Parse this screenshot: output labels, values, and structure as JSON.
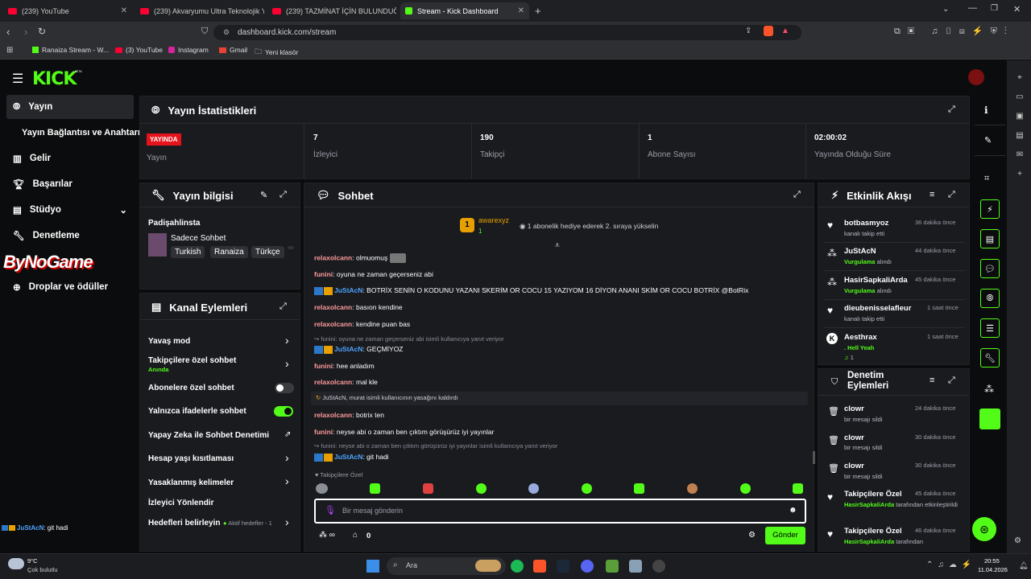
{
  "browser": {
    "tabs": [
      {
        "label": "(239) YouTube"
      },
      {
        "label": "(239) Akvaryumu Ultra Teknolojik Yap"
      },
      {
        "label": "(239) TAZMİNAT İÇİN BULUNDUĞU Ü"
      },
      {
        "label": "Stream - Kick Dashboard"
      }
    ],
    "url": "dashboard.kick.com/stream",
    "bookmarks": [
      "Ranaiza Stream - W...",
      "(3) YouTube",
      "Instagram",
      "Gmail",
      "Yeni klasör"
    ]
  },
  "sidebar": {
    "items": [
      {
        "label": "Yayın"
      },
      {
        "label": "Yayın Bağlantısı ve Anahtarı"
      },
      {
        "label": "Gelir"
      },
      {
        "label": "Başarılar"
      },
      {
        "label": "Stüdyo"
      },
      {
        "label": "Denetleme"
      },
      {
        "label": "Droplar ve ödüller"
      }
    ],
    "watermark": "ByNoGame",
    "mini_chat": {
      "user": "JuStAcN",
      "text": ": git hadi"
    }
  },
  "stats": {
    "title": "Yayın İstatistikleri",
    "live_badge": "YAYINDA",
    "live_label": "Yayın",
    "items": [
      {
        "value": "7",
        "label": "İzleyici"
      },
      {
        "value": "190",
        "label": "Takipçi"
      },
      {
        "value": "1",
        "label": "Abone Sayısı"
      },
      {
        "value": "02:00:02",
        "label": "Yayında Olduğu Süre"
      }
    ]
  },
  "info": {
    "title": "Yayın bilgisi",
    "stream_title": "Padişahlinsta",
    "category": "Sadece Sohbet",
    "tags": [
      "Turkish",
      "Ranaiza",
      "Türkçe"
    ]
  },
  "actions": {
    "title": "Kanal Eylemleri",
    "rows": [
      {
        "label": "Yavaş mod"
      },
      {
        "label": "Takipçilere özel sohbet",
        "sub": "Anında"
      },
      {
        "label": "Abonelere özel sohbet"
      },
      {
        "label": "Yalnızca ifadelerle sohbet"
      },
      {
        "label": "Yapay Zeka ile Sohbet Denetimi"
      },
      {
        "label": "Hesap yaşı kısıtlaması"
      },
      {
        "label": "Yasaklanmış kelimeler"
      },
      {
        "label": "İzleyici Yönlendir"
      },
      {
        "label": "Hedefleri belirleyin",
        "sub": "Aktif hedefler - 1"
      }
    ]
  },
  "chat": {
    "title": "Sohbet",
    "pinned_user": "awarexyz",
    "pinned_count": "1",
    "pinned_text": "1 abonelik hediye ederek 2. sıraya yükselin",
    "messages": [
      {
        "user": "relaxolcann",
        "text": " olmuomuş"
      },
      {
        "user": "funini",
        "text": " oyuna ne zaman geçerseniz abi"
      },
      {
        "user": "JuStAcN",
        "text": ": BOTRİX SENİN O KODUNU YAZANI SKERİM OR COCU 15 YAZIYOM 16 DİYON ANANI SKİM OR COCU BOTRİX @BotRix"
      },
      {
        "user": "relaxolcann",
        "text": " basıon kendine"
      },
      {
        "user": "relaxolcann",
        "text": " kendine puan bas"
      },
      {
        "reply": "funini: oyuna ne zaman geçerseniz abi isimli kullanıcıya yanıt veriyor"
      },
      {
        "user": "JuStAcN",
        "text": ": GEÇMİYOZ"
      },
      {
        "user": "funini",
        "text": " hee anladım"
      },
      {
        "user": "relaxolcann",
        "text": " mal kle"
      },
      {
        "system": "JuStAcN, murat isimli kullanıcının yasağını kaldırdı"
      },
      {
        "user": "relaxolcann",
        "text": " botrix ten"
      },
      {
        "user": "funini",
        "text": " neyse abi o zaman ben çıktım görüşürüz iyi yayınlar"
      },
      {
        "reply": "funini: neyse abi o zaman ben çıktım görüşürüz iyi yayınlar isimli kullanıcıya yanıt veriyor"
      },
      {
        "user": "JuStAcN",
        "text": ": git hadi"
      }
    ],
    "followers_label": "Takipçilere Özel",
    "input_placeholder": "Bir mesaj gönderin",
    "points": "0",
    "send_label": "Gönder"
  },
  "events": {
    "title": "Etkinlik Akışı",
    "items": [
      {
        "name": "botbasmyoz",
        "time": "36 dakika önce",
        "sub": "kanalı takip etti"
      },
      {
        "name": "JuStAcN",
        "time": "44 dakika önce",
        "sub_green": "Vurgulama",
        "sub": " alındı"
      },
      {
        "name": "HasirSapkaliArda",
        "time": "45 dakika önce",
        "sub_green": "Vurgulama",
        "sub": " alındı"
      },
      {
        "name": "dieubenisselafleur",
        "time": "1 saat önce",
        "sub": "kanalı takip etti"
      },
      {
        "name": "Aesthrax",
        "time": "1 saat önce",
        "sub_green": ". Hell Yeah",
        "sub": "1"
      }
    ]
  },
  "mod": {
    "title": "Denetim Eylemleri",
    "items": [
      {
        "name": "clowr",
        "time": "24 dakika önce",
        "sub": "bir mesajı sildi"
      },
      {
        "name": "clowr",
        "time": "30 dakika önce",
        "sub": "bir mesajı sildi"
      },
      {
        "name": "clowr",
        "time": "30 dakika önce",
        "sub": "bir mesajı sildi"
      },
      {
        "name": "Takipçilere Özel",
        "time": "45 dakika önce",
        "sub_green": "HasirSapkaliArda",
        "sub": " tarafından etkinleştirildi"
      },
      {
        "name": "Takipçilere Özel",
        "time": "46 dakika önce",
        "sub_green": "HasirSapkaliArda",
        "sub": " tarafından"
      }
    ]
  },
  "taskbar": {
    "weather_temp": "9°C",
    "weather_text": "Çok bulutlu",
    "search": "Ara",
    "time": "20:55",
    "date": "11.04.2026"
  },
  "colors": {
    "accent": "#53fc18",
    "live": "#e5141c",
    "panel": "#191b1f"
  }
}
